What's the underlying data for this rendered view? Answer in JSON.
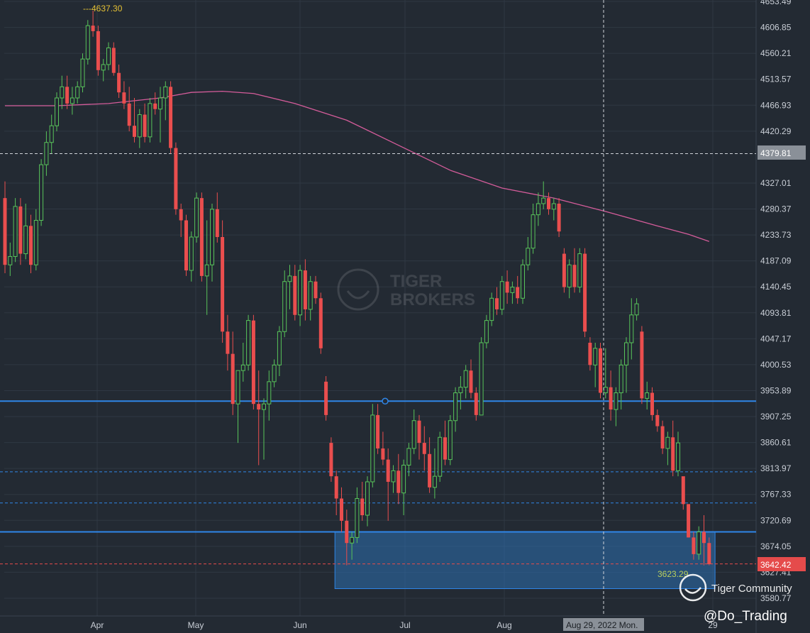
{
  "chart_data": {
    "type": "candlestick",
    "title": "",
    "xlabel": "",
    "ylabel": "",
    "ylim": [
      3555,
      4655
    ],
    "grid": true,
    "x_ticks": [
      "Apr",
      "May",
      "Jun",
      "Jul",
      "Aug",
      "29"
    ],
    "y_ticks": [
      "4653.49",
      "4606.85",
      "4560.21",
      "4513.57",
      "4466.93",
      "4420.29",
      "4327.01",
      "4280.37",
      "4233.73",
      "4187.09",
      "4140.45",
      "4093.81",
      "4047.17",
      "4000.53",
      "3953.89",
      "3907.25",
      "3860.61",
      "3813.97",
      "3767.33",
      "3720.69",
      "3674.05",
      "3627.41",
      "3580.77"
    ],
    "moving_average": [
      [
        0,
        4466
      ],
      [
        10,
        4466
      ],
      [
        20,
        4470
      ],
      [
        30,
        4480
      ],
      [
        36,
        4490
      ],
      [
        42,
        4492
      ],
      [
        48,
        4488
      ],
      [
        56,
        4470
      ],
      [
        66,
        4440
      ],
      [
        76,
        4395
      ],
      [
        86,
        4350
      ],
      [
        96,
        4318
      ],
      [
        106,
        4300
      ],
      [
        116,
        4276
      ],
      [
        126,
        4250
      ],
      [
        132,
        4235
      ],
      [
        136,
        4222
      ]
    ],
    "candles": [
      [
        0,
        4300,
        4330,
        4165,
        4180
      ],
      [
        1,
        4180,
        4220,
        4160,
        4195
      ],
      [
        2,
        4195,
        4300,
        4185,
        4285
      ],
      [
        3,
        4285,
        4300,
        4180,
        4200
      ],
      [
        4,
        4200,
        4290,
        4190,
        4250
      ],
      [
        5,
        4250,
        4270,
        4165,
        4180
      ],
      [
        6,
        4180,
        4280,
        4170,
        4260
      ],
      [
        7,
        4260,
        4370,
        4250,
        4360
      ],
      [
        8,
        4360,
        4420,
        4340,
        4400
      ],
      [
        9,
        4400,
        4450,
        4380,
        4430
      ],
      [
        10,
        4430,
        4490,
        4420,
        4480
      ],
      [
        11,
        4480,
        4520,
        4460,
        4500
      ],
      [
        12,
        4500,
        4520,
        4460,
        4470
      ],
      [
        13,
        4470,
        4500,
        4450,
        4480
      ],
      [
        14,
        4480,
        4510,
        4470,
        4500
      ],
      [
        15,
        4500,
        4560,
        4490,
        4550
      ],
      [
        16,
        4550,
        4620,
        4540,
        4610
      ],
      [
        17,
        4610,
        4637,
        4590,
        4600
      ],
      [
        18,
        4600,
        4610,
        4520,
        4530
      ],
      [
        19,
        4530,
        4550,
        4510,
        4540
      ],
      [
        20,
        4540,
        4580,
        4530,
        4570
      ],
      [
        21,
        4570,
        4580,
        4520,
        4525
      ],
      [
        22,
        4525,
        4540,
        4480,
        4490
      ],
      [
        23,
        4490,
        4510,
        4460,
        4470
      ],
      [
        24,
        4470,
        4500,
        4420,
        4430
      ],
      [
        25,
        4430,
        4480,
        4400,
        4410
      ],
      [
        26,
        4410,
        4460,
        4390,
        4450
      ],
      [
        27,
        4450,
        4470,
        4400,
        4410
      ],
      [
        28,
        4410,
        4480,
        4400,
        4470
      ],
      [
        29,
        4470,
        4490,
        4450,
        4460
      ],
      [
        30,
        4460,
        4500,
        4400,
        4480
      ],
      [
        31,
        4480,
        4510,
        4440,
        4500
      ],
      [
        32,
        4500,
        4510,
        4380,
        4390
      ],
      [
        33,
        4390,
        4400,
        4270,
        4280
      ],
      [
        34,
        4280,
        4290,
        4230,
        4260
      ],
      [
        35,
        4260,
        4270,
        4160,
        4170
      ],
      [
        36,
        4170,
        4240,
        4150,
        4230
      ],
      [
        37,
        4230,
        4310,
        4220,
        4300
      ],
      [
        38,
        4300,
        4310,
        4150,
        4160
      ],
      [
        39,
        4160,
        4260,
        4090,
        4180
      ],
      [
        40,
        4180,
        4290,
        4150,
        4280
      ],
      [
        41,
        4280,
        4310,
        4220,
        4230
      ],
      [
        42,
        4230,
        4260,
        4040,
        4060
      ],
      [
        43,
        4060,
        4090,
        3990,
        4020
      ],
      [
        44,
        4020,
        4060,
        3910,
        3930
      ],
      [
        45,
        3930,
        3980,
        3860,
        3990
      ],
      [
        46,
        3990,
        4040,
        3970,
        4000
      ],
      [
        47,
        4000,
        4090,
        3990,
        4080
      ],
      [
        48,
        4080,
        4090,
        3920,
        3930
      ],
      [
        49,
        3930,
        3990,
        3820,
        3920
      ],
      [
        50,
        3920,
        3940,
        3830,
        3930
      ],
      [
        51,
        3930,
        3990,
        3900,
        3970
      ],
      [
        52,
        3970,
        4010,
        3960,
        4000
      ],
      [
        53,
        4000,
        4070,
        3980,
        4060
      ],
      [
        54,
        4060,
        4170,
        4050,
        4150
      ],
      [
        55,
        4150,
        4180,
        4100,
        4160
      ],
      [
        56,
        4160,
        4180,
        4080,
        4090
      ],
      [
        57,
        4090,
        4180,
        4070,
        4170
      ],
      [
        58,
        4170,
        4190,
        4080,
        4100
      ],
      [
        59,
        4100,
        4160,
        4080,
        4150
      ],
      [
        60,
        4150,
        4160,
        4110,
        4120
      ],
      [
        61,
        4120,
        4130,
        4020,
        4030
      ],
      [
        62,
        3970,
        3980,
        3900,
        3910
      ],
      [
        63,
        3860,
        3870,
        3790,
        3800
      ],
      [
        64,
        3800,
        3810,
        3730,
        3760
      ],
      [
        65,
        3760,
        3780,
        3700,
        3720
      ],
      [
        66,
        3720,
        3740,
        3640,
        3680
      ],
      [
        67,
        3680,
        3700,
        3650,
        3690
      ],
      [
        68,
        3690,
        3780,
        3680,
        3760
      ],
      [
        69,
        3760,
        3790,
        3720,
        3730
      ],
      [
        70,
        3730,
        3800,
        3710,
        3790
      ],
      [
        71,
        3790,
        3930,
        3780,
        3910
      ],
      [
        72,
        3910,
        3930,
        3840,
        3850
      ],
      [
        73,
        3850,
        3880,
        3820,
        3830
      ],
      [
        74,
        3830,
        3850,
        3720,
        3790
      ],
      [
        75,
        3790,
        3820,
        3770,
        3810
      ],
      [
        76,
        3810,
        3840,
        3750,
        3770
      ],
      [
        77,
        3770,
        3830,
        3730,
        3820
      ],
      [
        78,
        3820,
        3860,
        3800,
        3850
      ],
      [
        79,
        3850,
        3920,
        3840,
        3900
      ],
      [
        80,
        3900,
        3910,
        3830,
        3860
      ],
      [
        81,
        3860,
        3890,
        3810,
        3840
      ],
      [
        82,
        3840,
        3870,
        3770,
        3780
      ],
      [
        83,
        3780,
        3850,
        3760,
        3800
      ],
      [
        84,
        3800,
        3880,
        3790,
        3870
      ],
      [
        85,
        3870,
        3900,
        3820,
        3830
      ],
      [
        86,
        3830,
        3910,
        3820,
        3900
      ],
      [
        87,
        3900,
        3960,
        3880,
        3950
      ],
      [
        88,
        3950,
        3980,
        3920,
        3960
      ],
      [
        89,
        3960,
        4000,
        3940,
        3990
      ],
      [
        90,
        3990,
        4010,
        3940,
        3950
      ],
      [
        91,
        3950,
        3960,
        3900,
        3910
      ],
      [
        92,
        3910,
        4050,
        3910,
        4040
      ],
      [
        93,
        4040,
        4090,
        4030,
        4080
      ],
      [
        94,
        4080,
        4130,
        4070,
        4120
      ],
      [
        95,
        4120,
        4140,
        4090,
        4100
      ],
      [
        96,
        4100,
        4160,
        4090,
        4150
      ],
      [
        97,
        4150,
        4170,
        4110,
        4130
      ],
      [
        98,
        4130,
        4150,
        4110,
        4140
      ],
      [
        99,
        4140,
        4160,
        4110,
        4120
      ],
      [
        100,
        4120,
        4190,
        4110,
        4180
      ],
      [
        101,
        4180,
        4230,
        4170,
        4210
      ],
      [
        102,
        4210,
        4290,
        4200,
        4270
      ],
      [
        103,
        4270,
        4310,
        4250,
        4290
      ],
      [
        104,
        4290,
        4330,
        4280,
        4300
      ],
      [
        105,
        4300,
        4310,
        4270,
        4280
      ],
      [
        106,
        4280,
        4300,
        4260,
        4290
      ],
      [
        107,
        4290,
        4300,
        4230,
        4240
      ],
      [
        108,
        4200,
        4210,
        4130,
        4140
      ],
      [
        109,
        4140,
        4190,
        4120,
        4180
      ],
      [
        110,
        4180,
        4210,
        4130,
        4140
      ],
      [
        111,
        4140,
        4210,
        4130,
        4200
      ],
      [
        112,
        4200,
        4210,
        4050,
        4060
      ],
      [
        113,
        4040,
        4050,
        3990,
        4000
      ],
      [
        114,
        4000,
        4040,
        3960,
        4030
      ],
      [
        115,
        4030,
        4040,
        3940,
        3950
      ],
      [
        116,
        3950,
        4030,
        3940,
        3960
      ],
      [
        117,
        3960,
        3990,
        3900,
        3920
      ],
      [
        118,
        3920,
        3960,
        3890,
        3950
      ],
      [
        119,
        3950,
        4010,
        3920,
        4000
      ],
      [
        120,
        4000,
        4050,
        3950,
        4040
      ],
      [
        121,
        4040,
        4120,
        4010,
        4090
      ],
      [
        122,
        4090,
        4120,
        4080,
        4110
      ],
      [
        123,
        4060,
        4070,
        3930,
        3940
      ],
      [
        124,
        3940,
        3970,
        3920,
        3950
      ],
      [
        125,
        3950,
        3960,
        3900,
        3910
      ],
      [
        126,
        3910,
        3920,
        3880,
        3890
      ],
      [
        127,
        3890,
        3900,
        3840,
        3850
      ],
      [
        128,
        3850,
        3880,
        3820,
        3870
      ],
      [
        129,
        3870,
        3900,
        3800,
        3810
      ],
      [
        130,
        3810,
        3880,
        3800,
        3860
      ],
      [
        131,
        3800,
        3790,
        3740,
        3750
      ],
      [
        132,
        3750,
        3720,
        3690,
        3690
      ],
      [
        133,
        3690,
        3700,
        3650,
        3660
      ],
      [
        134,
        3660,
        3710,
        3650,
        3700
      ],
      [
        135,
        3700,
        3730,
        3640,
        3680
      ],
      [
        136,
        3680,
        3690,
        3640,
        3642
      ]
    ],
    "annotations": {
      "high_label": "4637.30",
      "low_label": "3623.29",
      "current_price": "3642.42",
      "crosshair_price": "4379.81",
      "crosshair_date": "Aug 29, 2022 Mon."
    },
    "horizontal_lines": [
      {
        "value": 3935,
        "style": "solid",
        "color": "#2f86e8"
      },
      {
        "value": 3700,
        "style": "solid",
        "color": "#2f86e8"
      },
      {
        "value": 3808,
        "style": "dashed",
        "color": "#2f86e8"
      },
      {
        "value": 3752,
        "style": "dashed",
        "color": "#2f86e8"
      },
      {
        "value": 3642.42,
        "style": "dashed",
        "color": "#e54b4b"
      },
      {
        "value": 4379.81,
        "style": "dashed",
        "color": "#d0d4da"
      }
    ],
    "zone": {
      "y_top": 3700,
      "y_bottom": 3598,
      "x_start": 64,
      "x_end": 137
    },
    "colors": {
      "up": "#58c45a",
      "down": "#ea4e4e",
      "ma": "#d45c9a",
      "line": "#2f86e8",
      "zone": "#2e6fb0"
    }
  },
  "watermark": {
    "brand_line1": "TIGER",
    "brand_line2": "BROKERS",
    "community": "Tiger Community",
    "handle": "@Do_Trading"
  }
}
